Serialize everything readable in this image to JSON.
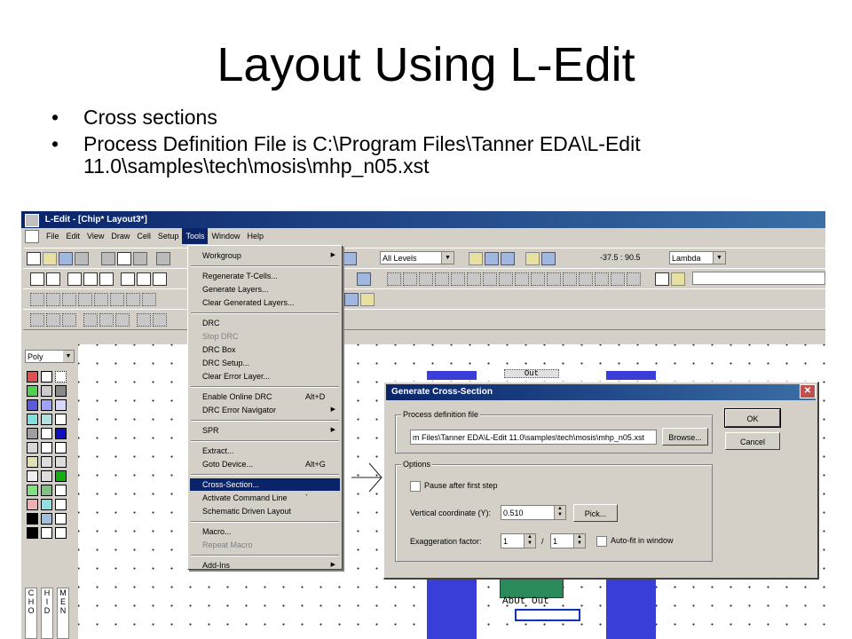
{
  "slide": {
    "title": "Layout Using L-Edit",
    "bullets": [
      "Cross sections",
      "Process Definition File is C:\\Program Files\\Tanner EDA\\L-Edit 11.0\\samples\\tech\\mosis\\mhp_n05.xst"
    ]
  },
  "window": {
    "title": "L-Edit - [Chip*     Layout3*]"
  },
  "menubar": [
    "File",
    "Edit",
    "View",
    "Draw",
    "Cell",
    "Setup",
    "Tools",
    "Window",
    "Help"
  ],
  "toolbar": {
    "levels_label": "All Levels",
    "coordinates": "-37.5 : 90.5",
    "units_label": "Lambda"
  },
  "layer_panel": {
    "current_layer": "Poly",
    "tabs": [
      "C\nH\nO",
      "H\nI\nD",
      "M\nE\nN"
    ]
  },
  "tools_menu": {
    "items": [
      {
        "label": "Workgroup",
        "submenu": true
      },
      {
        "sep": true
      },
      {
        "label": "Regenerate T-Cells..."
      },
      {
        "label": "Generate Layers..."
      },
      {
        "label": "Clear Generated Layers..."
      },
      {
        "sep": true
      },
      {
        "label": "DRC"
      },
      {
        "label": "Stop DRC",
        "disabled": true
      },
      {
        "label": "DRC Box"
      },
      {
        "label": "DRC Setup..."
      },
      {
        "label": "Clear Error Layer..."
      },
      {
        "sep": true
      },
      {
        "label": "Enable Online DRC",
        "shortcut": "Alt+D"
      },
      {
        "label": "DRC Error Navigator",
        "submenu": true
      },
      {
        "sep": true
      },
      {
        "label": "SPR",
        "submenu": true
      },
      {
        "sep": true
      },
      {
        "label": "Extract..."
      },
      {
        "label": "Goto Device...",
        "shortcut": "Alt+G"
      },
      {
        "sep": true
      },
      {
        "label": "Cross-Section...",
        "highlighted": true
      },
      {
        "label": "Activate Command Line",
        "shortcut": "`"
      },
      {
        "label": "Schematic Driven Layout"
      },
      {
        "sep": true
      },
      {
        "label": "Macro..."
      },
      {
        "label": "Repeat Macro",
        "disabled": true
      },
      {
        "sep": true
      },
      {
        "label": "Add-Ins",
        "submenu": true
      }
    ]
  },
  "dialog": {
    "title": "Generate Cross-Section",
    "process_group_label": "Process definition file",
    "process_file_value": "m Files\\Tanner EDA\\L-Edit 11.0\\samples\\tech\\mosis\\mhp_n05.xst",
    "browse_label": "Browse...",
    "ok_label": "OK",
    "cancel_label": "Cancel",
    "options_group_label": "Options",
    "pause_label": "Pause after first step",
    "vertical_label": "Vertical coordinate (Y):",
    "vertical_value": "0.510",
    "pick_label": "Pick...",
    "exaggeration_label": "Exaggeration factor:",
    "exag_num": "1",
    "exag_sep": "/",
    "exag_den": "1",
    "autofit_label": "Auto-fit in window"
  },
  "layout_labels": {
    "out_top": "Out",
    "bottom_label": "AbUt  Out"
  },
  "colors": {
    "titlebar": "#0a246a",
    "metal": "#3a3ed8",
    "highlight": "#0a246a"
  }
}
